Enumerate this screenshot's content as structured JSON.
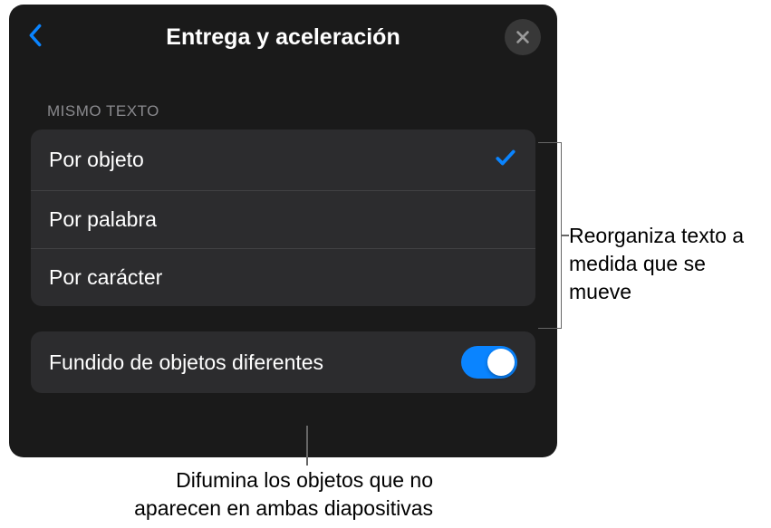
{
  "header": {
    "title": "Entrega y aceleración"
  },
  "sections": {
    "sameText": {
      "header": "MISMO TEXTO",
      "options": [
        {
          "label": "Por objeto",
          "selected": true
        },
        {
          "label": "Por palabra",
          "selected": false
        },
        {
          "label": "Por carácter",
          "selected": false
        }
      ]
    },
    "fade": {
      "label": "Fundido de objetos diferentes",
      "enabled": true
    }
  },
  "callouts": {
    "right": "Reorganiza texto a medida que se mueve",
    "bottom": "Difumina los objetos que no aparecen en ambas diapositivas"
  }
}
